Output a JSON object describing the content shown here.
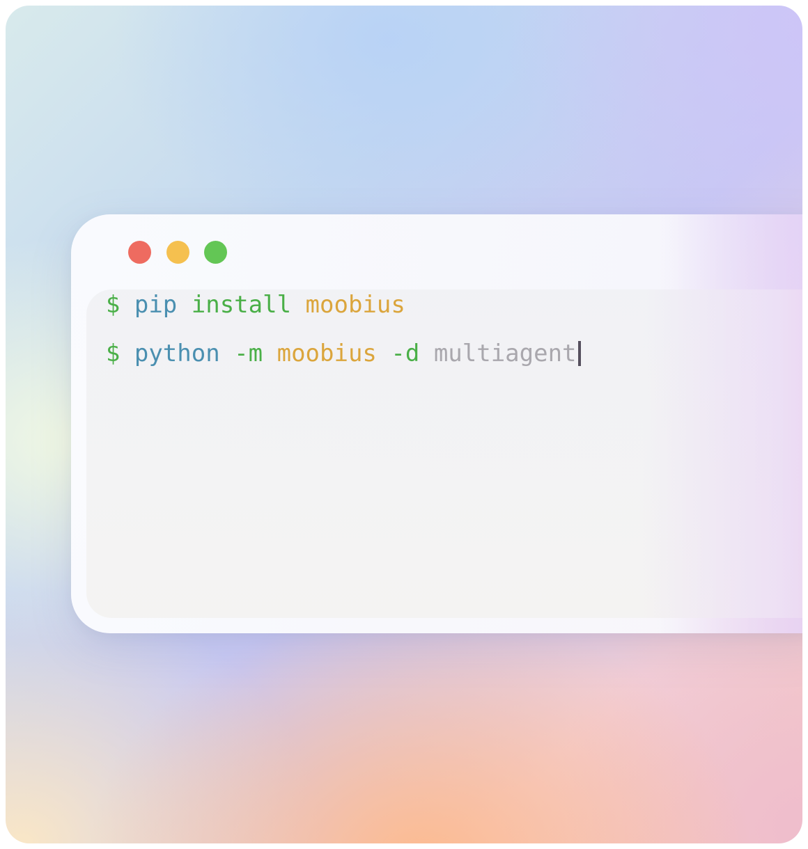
{
  "colors": {
    "prompt": "#4aaf47",
    "command": "#4a8fb0",
    "subcommand": "#4aaf47",
    "package": "#dba53c",
    "argument": "#a9a7ad",
    "window_close": "#ee6b60",
    "window_minimize": "#f5c04f",
    "window_maximize": "#63c655"
  },
  "window": {
    "controls": [
      "close-dot",
      "minimize-dot",
      "maximize-dot"
    ]
  },
  "terminal": {
    "lines": [
      {
        "prompt": "$",
        "command": "pip",
        "subcommand": "install",
        "package": "moobius"
      },
      {
        "prompt": "$",
        "command": "python",
        "flag1": "-m",
        "package": "moobius",
        "flag2": "-d",
        "argument": "multiagent"
      }
    ]
  }
}
